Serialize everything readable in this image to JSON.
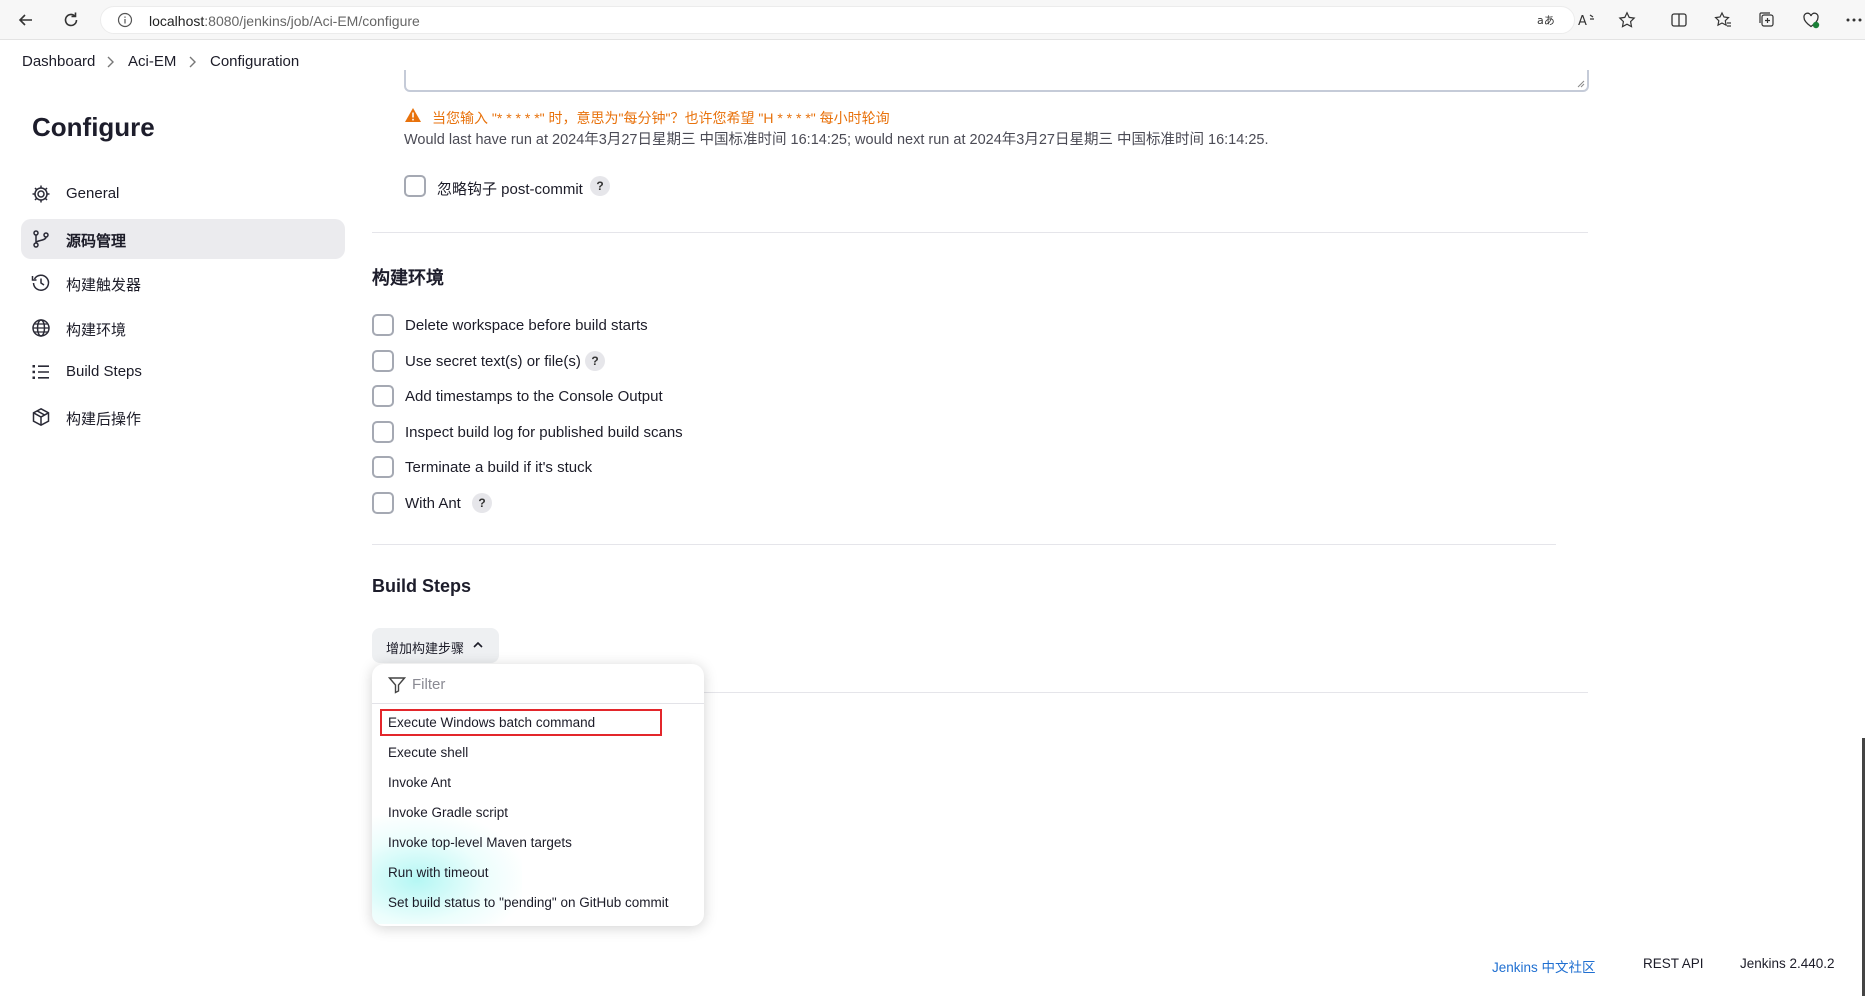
{
  "browser": {
    "url_host": "localhost",
    "url_rest": ":8080/jenkins/job/Aci-EM/configure"
  },
  "breadcrumb": [
    "Dashboard",
    "Aci-EM",
    "Configuration"
  ],
  "sidebar": {
    "title": "Configure",
    "items": [
      {
        "label": "General",
        "icon": "gear-icon",
        "active": false
      },
      {
        "label": "源码管理",
        "icon": "branch-icon",
        "active": true
      },
      {
        "label": "构建触发器",
        "icon": "clock-icon",
        "active": false
      },
      {
        "label": "构建环境",
        "icon": "globe-icon",
        "active": false
      },
      {
        "label": "Build Steps",
        "icon": "list-icon",
        "active": false
      },
      {
        "label": "构建后操作",
        "icon": "package-icon",
        "active": false
      }
    ]
  },
  "triggers": {
    "warning": "当您输入 \"* * * * *\" 时，意思为\"每分钟\"？也许您希望 \"H * * * *\" 每小时轮询",
    "info": "Would last have run at 2024年3月27日星期三 中国标准时间 16:14:25; would next run at 2024年3月27日星期三 中国标准时间 16:14:25.",
    "ignore_post_commit": "忽略钩子 post-commit"
  },
  "build_env": {
    "title": "构建环境",
    "options": [
      {
        "label": "Delete workspace before build starts",
        "help": false
      },
      {
        "label": "Use secret text(s) or file(s)",
        "help": true
      },
      {
        "label": "Add timestamps to the Console Output",
        "help": false
      },
      {
        "label": "Inspect build log for published build scans",
        "help": false
      },
      {
        "label": "Terminate a build if it's stuck",
        "help": false
      },
      {
        "label": "With Ant",
        "help": true
      }
    ]
  },
  "build_steps": {
    "title": "Build Steps",
    "add_button": "增加构建步骤",
    "filter_placeholder": "Filter",
    "menu": [
      "Execute Windows batch command",
      "Execute shell",
      "Invoke Ant",
      "Invoke Gradle script",
      "Invoke top-level Maven targets",
      "Run with timeout",
      "Set build status to \"pending\" on GitHub commit"
    ]
  },
  "footer": {
    "community": "Jenkins 中文社区",
    "rest_api": "REST API",
    "version": "Jenkins 2.440.2"
  },
  "colors": {
    "warning": "#e8720c",
    "link": "#1f6fd1",
    "highlight_border": "#e3262b",
    "active_sidebar": "#ebebee"
  }
}
